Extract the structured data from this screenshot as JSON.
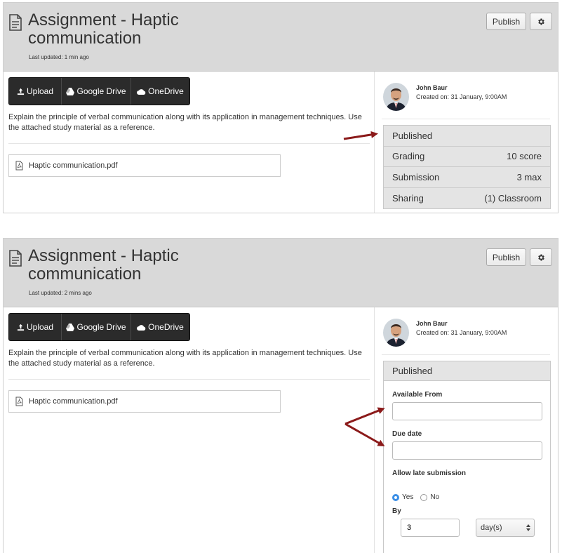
{
  "panels": [
    {
      "header": {
        "title": "Assignment - Haptic communication",
        "last_updated": "Last updated: 1 min ago",
        "publish_label": "Publish"
      },
      "upload": {
        "upload_label": "Upload",
        "google_drive_label": "Google Drive",
        "onedrive_label": "OneDrive"
      },
      "description": "Explain the principle of verbal communication along with its application in management techniques. Use the attached study material as a reference.",
      "attachment": "Haptic communication.pdf",
      "author": {
        "name": "John Baur",
        "created": "Created on: 31 January, 9:00AM"
      },
      "status": {
        "heading": "Published",
        "rows": [
          {
            "label": "Grading",
            "value": "10 score"
          },
          {
            "label": "Submission",
            "value": "3 max"
          },
          {
            "label": "Sharing",
            "value": "(1) Classroom"
          }
        ]
      }
    },
    {
      "header": {
        "title": "Assignment - Haptic communication",
        "last_updated": "Last updated: 2 mins ago",
        "publish_label": "Publish"
      },
      "upload": {
        "upload_label": "Upload",
        "google_drive_label": "Google Drive",
        "onedrive_label": "OneDrive"
      },
      "description": "Explain the principle of verbal communication along with its application in management techniques. Use the attached study material as a reference.",
      "attachment": "Haptic communication.pdf",
      "author": {
        "name": "John Baur",
        "created": "Created on: 31 January, 9:00AM"
      },
      "form": {
        "heading": "Published",
        "available_from_label": "Available From",
        "available_from_value": "",
        "due_date_label": "Due date",
        "due_date_value": "",
        "late_label": "Allow late submission",
        "yes_label": "Yes",
        "no_label": "No",
        "late_selected": "Yes",
        "by_label": "By",
        "by_value": "3",
        "unit_value": "day(s)"
      }
    }
  ],
  "colors": {
    "header_bg": "#d9d9d9",
    "upload_bar": "#2b2b2b",
    "arrow": "#8b1a1a",
    "radio_on": "#3a8ee6"
  },
  "icons": [
    "document-icon",
    "gear-icon",
    "upload-icon",
    "google-drive-icon",
    "onedrive-icon",
    "pdf-icon",
    "avatar",
    "arrow-annotation"
  ]
}
